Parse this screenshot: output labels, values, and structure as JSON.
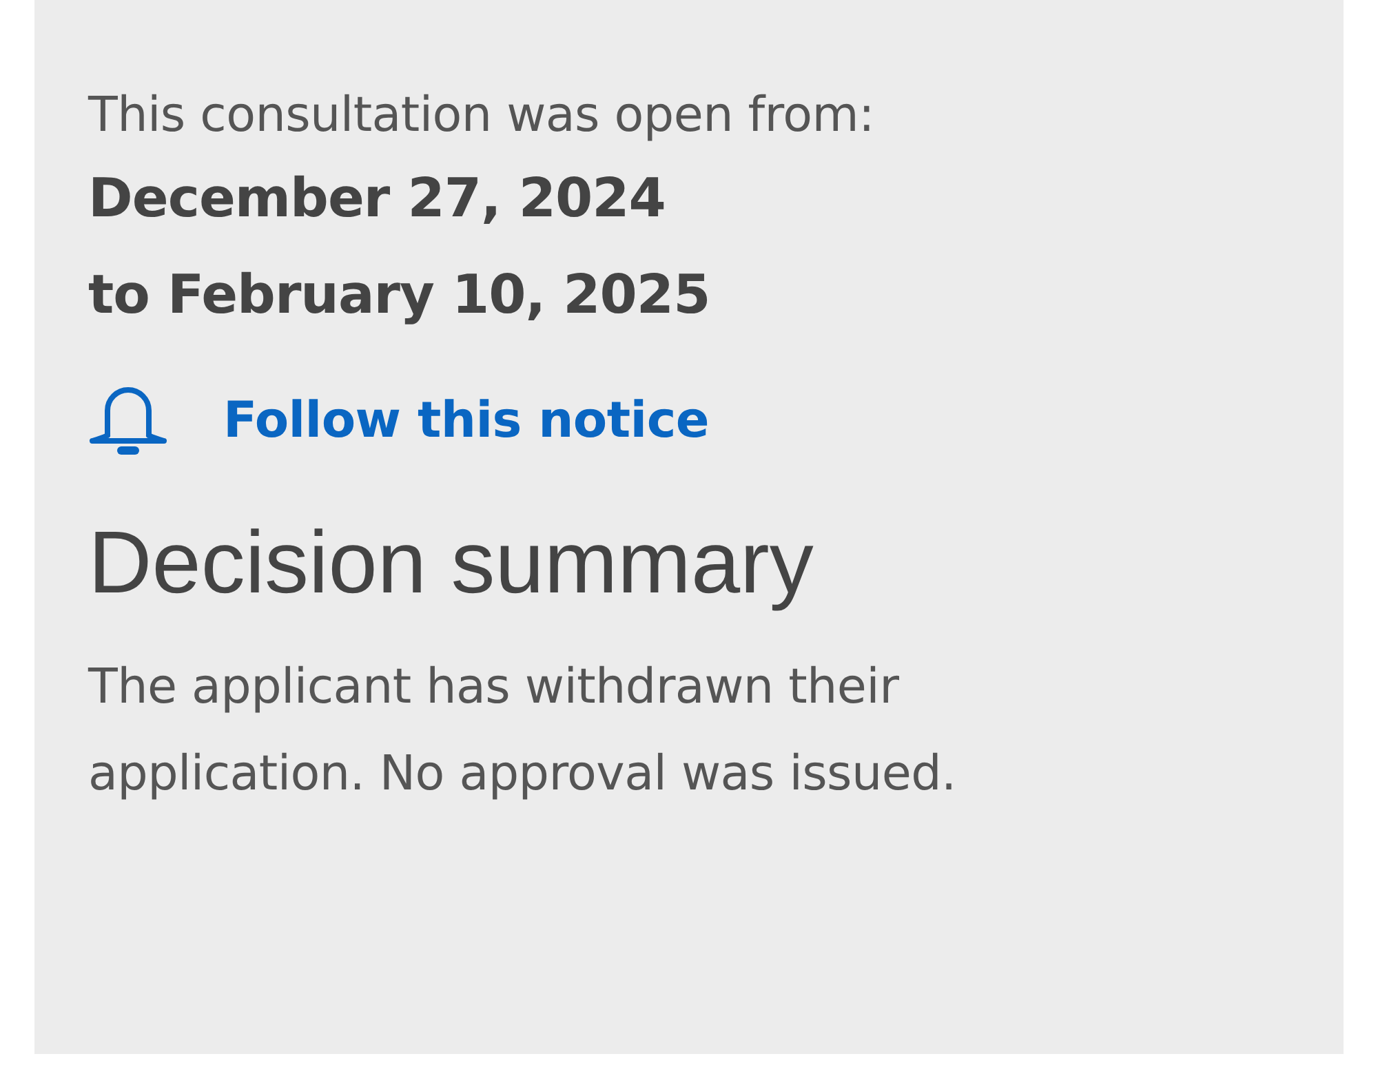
{
  "consultation": {
    "intro": "This consultation was open from:",
    "start_date": "December 27, 2024",
    "end_date": "to February 10, 2025"
  },
  "follow_link": {
    "label": "Follow this notice"
  },
  "decision": {
    "heading": "Decision summary",
    "text": "The applicant has withdrawn their application. No approval was issued."
  }
}
